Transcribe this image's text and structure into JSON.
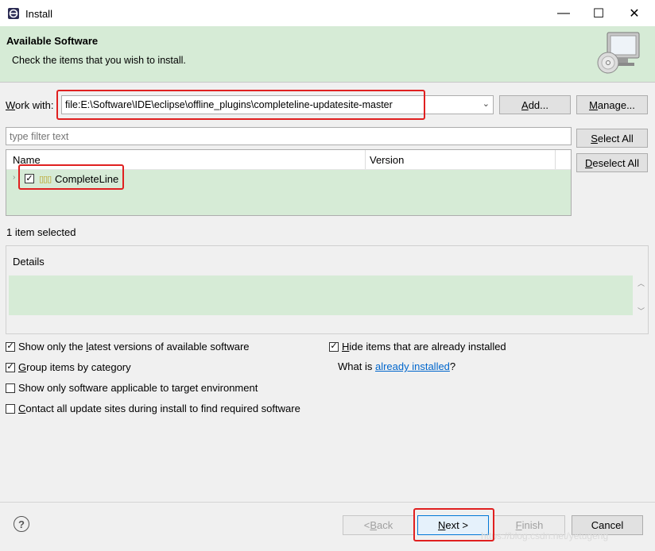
{
  "window": {
    "title": "Install",
    "minimize_glyph": "—",
    "maximize_glyph": "☐",
    "close_glyph": "✕"
  },
  "header": {
    "title": "Available Software",
    "description": "Check the items that you wish to install."
  },
  "work_with": {
    "label_u": "W",
    "label_rest": "ork with:",
    "value": "file:E:\\Software\\IDE\\eclipse\\offline_plugins\\completeline-updatesite-master",
    "dropdown_glyph": "⌄",
    "add_label_u": "A",
    "add_label_rest": "dd...",
    "manage_label_u": "M",
    "manage_label_rest": "anage..."
  },
  "filter": {
    "placeholder": "type filter text",
    "select_all_u": "S",
    "select_all_rest": "elect All",
    "deselect_all_u": "D",
    "deselect_all_rest": "eselect All"
  },
  "table": {
    "columns": [
      "Name",
      "Version"
    ],
    "rows": [
      {
        "name": "CompleteLine",
        "version": "",
        "checked_glyph": "✓",
        "icon_glyph": "▯▯▯",
        "expander_glyph": "›"
      }
    ]
  },
  "status": "1 item selected",
  "details": {
    "label": "Details",
    "scroll_up_glyph": "︿",
    "scroll_down_glyph": "﹀"
  },
  "options": {
    "show_latest_u": "l",
    "show_latest_pre": "Show only the ",
    "show_latest_post": "atest versions of available software",
    "hide_installed_u": "H",
    "hide_installed_rest": "ide items that are already installed",
    "group_u": "G",
    "group_rest": "roup items by category",
    "show_applicable": "Show only software applicable to target environment",
    "contact_u": "C",
    "contact_rest": "ontact all update sites during install to find required software",
    "what_is": "What is ",
    "already_installed_link": "already installed",
    "question_mark": "?"
  },
  "buttons": {
    "help_glyph": "?",
    "back_pre": "< ",
    "back_u": "B",
    "back_rest": "ack",
    "next_u": "N",
    "next_rest": "ext >",
    "finish_u": "F",
    "finish_rest": "inish",
    "cancel": "Cancel"
  },
  "watermark": "https://blog.csdn.net/yetugeng",
  "colors": {
    "banner_bg": "#d6ebd6",
    "highlight": "#e02020",
    "link": "#0066cc"
  }
}
